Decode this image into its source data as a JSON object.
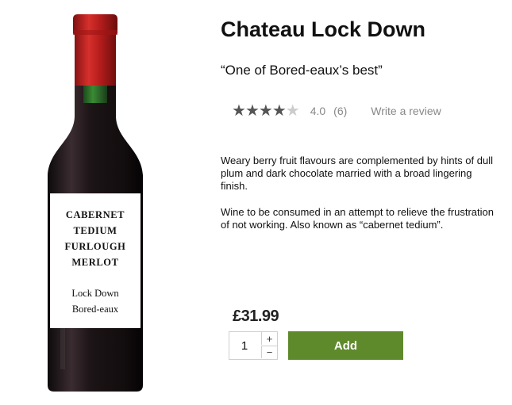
{
  "product": {
    "title": "Chateau Lock Down",
    "tagline": "“One of Bored-eaux’s best”",
    "rating": {
      "stars_filled": 4,
      "stars_total": 5,
      "value": "4.0",
      "count": "(6)",
      "write_review_label": "Write a review"
    },
    "description": [
      "Weary berry fruit flavours are complemented by hints of dull plum and dark chocolate married with a broad lingering finish.",
      "Wine to be consumed in an attempt to relieve the frustration of not working. Also known as “cabernet tedium”."
    ],
    "bottle_label": {
      "lines": [
        "CABERNET",
        "TEDIUM",
        "FURLOUGH",
        "MERLOT"
      ],
      "sub_lines": [
        "Lock Down",
        "Bored-eaux"
      ]
    },
    "price": "£31.99",
    "quantity": "1",
    "qty_plus": "+",
    "qty_minus": "−",
    "add_label": "Add"
  },
  "colors": {
    "add_button": "#5f8a2c",
    "capsule": "#c0201f",
    "bottle": "#1a1416"
  },
  "icons": {
    "star_full": "star-full-icon",
    "star_empty": "star-empty-icon"
  }
}
